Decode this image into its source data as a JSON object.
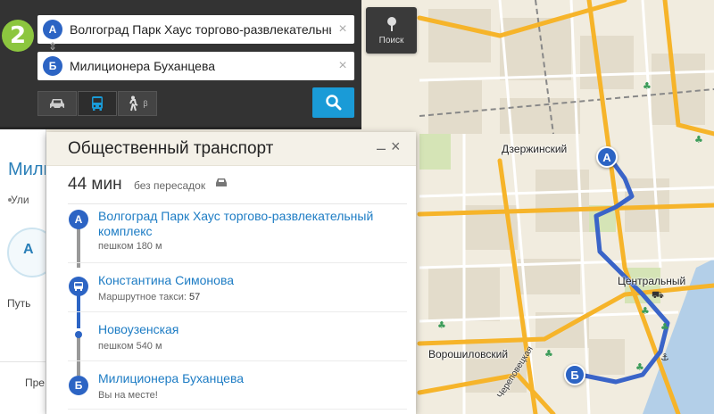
{
  "map": {
    "labels": {
      "dzerzhinsky": "Дзержинский",
      "tsentralny": "Центральный",
      "voroshilovsky": "Ворошиловский",
      "street": "Череповецкая"
    },
    "colors": {
      "route": "#3a64c8",
      "major_road": "#f6b42a",
      "minor_road": "#ffffff",
      "block": "#e5dfcf",
      "water": "#aac9e6",
      "green": "#cfe1b0"
    }
  },
  "search": {
    "logo": "2",
    "from": {
      "point": "А",
      "value": "Волгоград Парк Хаус торгово-развлекательный"
    },
    "to": {
      "point": "Б",
      "value": "Милиционера Буханцева"
    },
    "clear_icon": "×",
    "modes": [
      {
        "name": "car-icon",
        "active": false
      },
      {
        "name": "bus-icon",
        "active": true
      },
      {
        "name": "walk-icon",
        "active": false,
        "sup": "β"
      }
    ],
    "search_icon": "magnifier-icon",
    "poisk_label": "Поиск"
  },
  "left_panel": {
    "title": "Мили",
    "sub": "Ули",
    "circle_text": "А",
    "path_label": "Путь",
    "pre_label": "Пре"
  },
  "card": {
    "title": "Общественный транспорт",
    "duration": "44 мин",
    "transfers": "без пересадок",
    "steps": [
      {
        "marker": "А",
        "name": "Волгоград Парк Хаус торгово-развлекательный комплекс",
        "meta": "пешком 180 м"
      },
      {
        "marker": "bus-icon",
        "name": "Константина Симонова",
        "meta": "Маршрутное такси:",
        "route": "57"
      },
      {
        "marker": "dot",
        "name": "Новоузенская",
        "meta": "пешком 540 м"
      },
      {
        "marker": "Б",
        "name": "Милиционера Буханцева",
        "meta": "Вы на месте!"
      }
    ]
  }
}
